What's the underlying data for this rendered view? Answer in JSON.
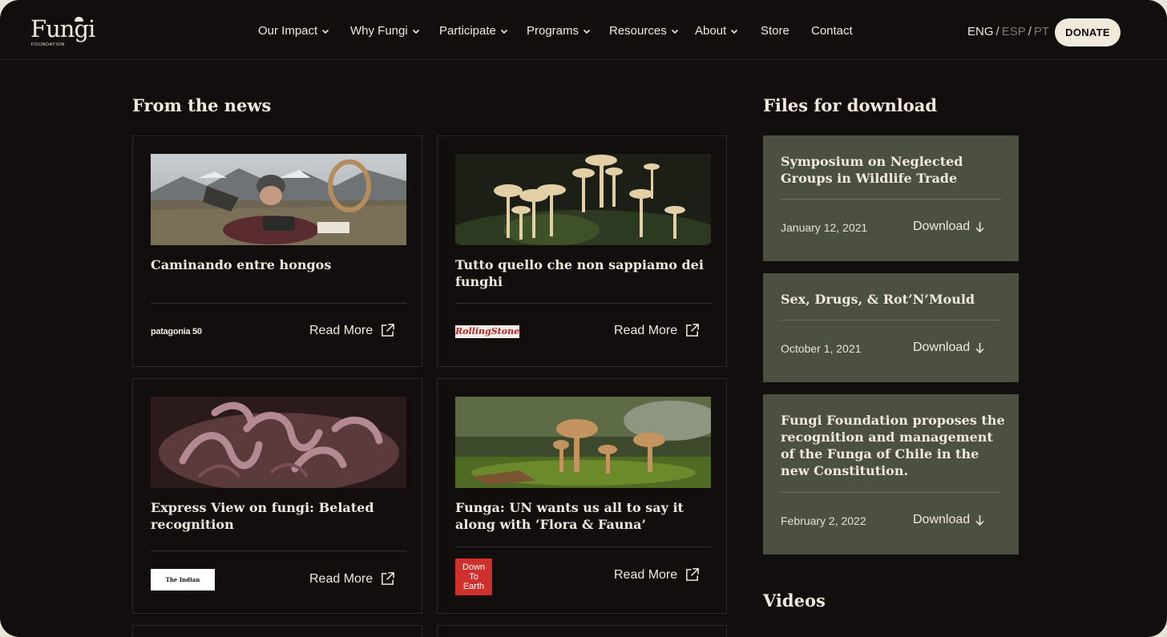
{
  "header": {
    "logo_word": "Fungi",
    "logo_sub": "FOUNDATION",
    "nav": [
      {
        "label": "Our Impact",
        "dropdown": true
      },
      {
        "label": "Why Fungi",
        "dropdown": true
      },
      {
        "label": "Participate",
        "dropdown": true
      },
      {
        "label": "Programs",
        "dropdown": true
      },
      {
        "label": "Resources",
        "dropdown": true
      },
      {
        "label": "About",
        "dropdown": true
      },
      {
        "label": "Store",
        "dropdown": false
      },
      {
        "label": "Contact",
        "dropdown": false
      }
    ],
    "languages": {
      "eng": "ENG",
      "esp": "ESP",
      "pt": "PT",
      "separator": "/"
    },
    "donate_label": "DONATE"
  },
  "news": {
    "title": "From the news",
    "cards": [
      {
        "title": "Caminando entre hongos",
        "source": "patagonia 50",
        "read_more": "Read More"
      },
      {
        "title": "Tutto quello che non sappiamo dei funghi",
        "source": "RollingStone",
        "read_more": "Read More"
      },
      {
        "title": "Express View on fungi: Belated recognition",
        "source": "The Indian EXPRESS",
        "read_more": "Read More"
      },
      {
        "title": "Funga: UN wants us all to say it along with ‘Flora & Fauna’",
        "source": "Down To Earth",
        "source_lines": [
          "Down",
          "To",
          "Earth"
        ],
        "read_more": "Read More"
      }
    ]
  },
  "files": {
    "title": "Files for download",
    "items": [
      {
        "title": "Symposium on Neglected Groups in Wildlife Trade",
        "date": "January 12, 2021",
        "download": "Download"
      },
      {
        "title": "Sex, Drugs, & Rot’N’Mould",
        "date": "October 1, 2021",
        "download": "Download"
      },
      {
        "title": "Fungi Foundation proposes the recognition and management of the Funga of Chile in the new Constitution.",
        "date": "February 2, 2022",
        "download": "Download"
      }
    ]
  },
  "videos": {
    "title": "Videos"
  },
  "colors": {
    "background": "#120e0d",
    "text": "#f1e9dc",
    "file_card": "#4b5042",
    "donate_button": "#f1e9dc"
  }
}
